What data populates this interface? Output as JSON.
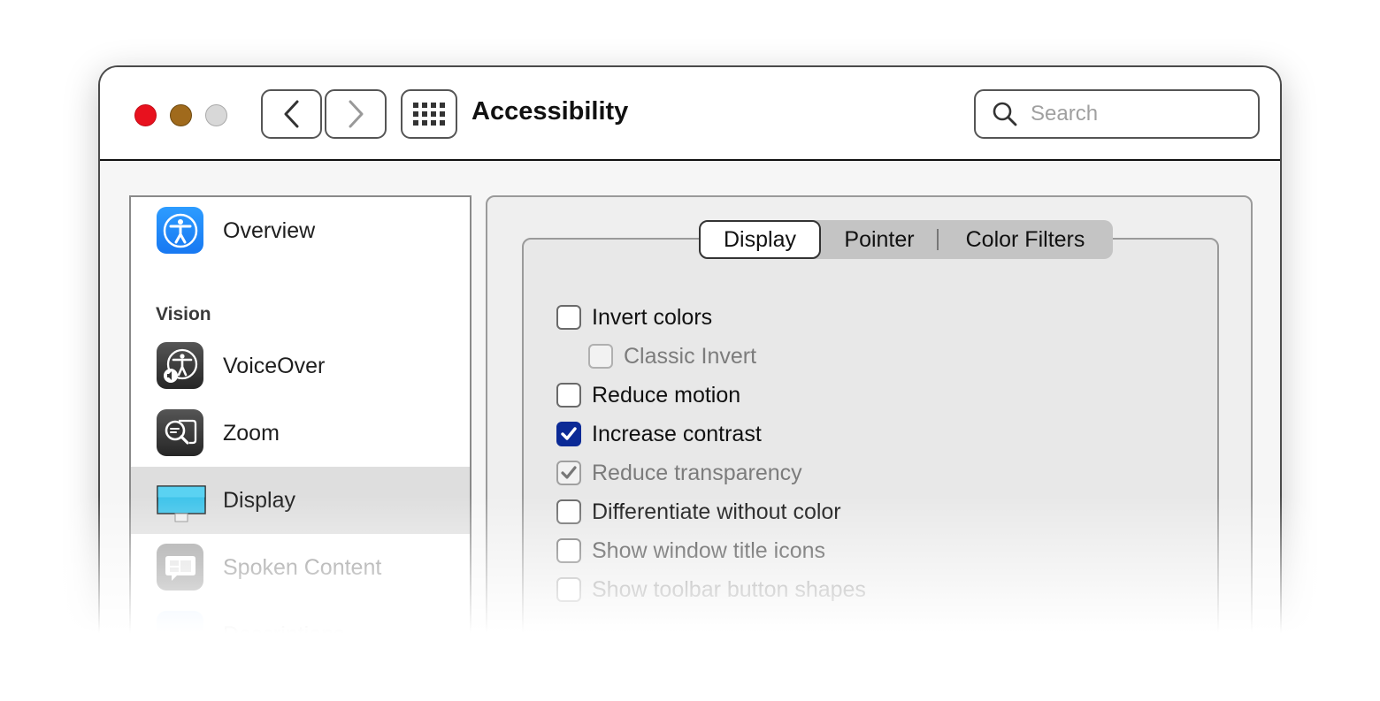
{
  "window": {
    "title": "Accessibility",
    "traffic_lights": [
      {
        "name": "close",
        "color": "#e8111e"
      },
      {
        "name": "minimize",
        "color": "#a06a1c"
      },
      {
        "name": "zoom",
        "color": "#d8d8d8"
      }
    ]
  },
  "toolbar": {
    "back_icon": "chevron-left",
    "forward_icon": "chevron-right",
    "show_all_icon": "grid-dots",
    "search": {
      "placeholder": "Search",
      "value": ""
    }
  },
  "sidebar": {
    "items": [
      {
        "label": "Overview",
        "icon": "accessibility-icon",
        "selected": false
      },
      {
        "label": "VoiceOver",
        "icon": "voiceover-icon",
        "selected": false
      },
      {
        "label": "Zoom",
        "icon": "zoom-icon",
        "selected": false
      },
      {
        "label": "Display",
        "icon": "display-icon",
        "selected": true
      },
      {
        "label": "Spoken Content",
        "icon": "spoken-content-icon",
        "selected": false
      },
      {
        "label": "Descriptions",
        "icon": "descriptions-icon",
        "selected": false
      }
    ],
    "section_vision": "Vision"
  },
  "content": {
    "tabs": [
      {
        "label": "Display",
        "active": true
      },
      {
        "label": "Pointer",
        "active": false
      },
      {
        "label": "Color Filters",
        "active": false
      }
    ],
    "options": [
      {
        "label": "Invert colors",
        "checked": false,
        "enabled": true,
        "indent": false
      },
      {
        "label": "Classic Invert",
        "checked": false,
        "enabled": false,
        "indent": true
      },
      {
        "label": "Reduce motion",
        "checked": false,
        "enabled": true,
        "indent": false
      },
      {
        "label": "Increase contrast",
        "checked": true,
        "enabled": true,
        "indent": false
      },
      {
        "label": "Reduce transparency",
        "checked": true,
        "enabled": false,
        "indent": false
      },
      {
        "label": "Differentiate without color",
        "checked": false,
        "enabled": true,
        "indent": false
      },
      {
        "label": "Show window title icons",
        "checked": false,
        "enabled": true,
        "indent": false
      },
      {
        "label": "Show toolbar button shapes",
        "checked": false,
        "enabled": false,
        "indent": false
      }
    ],
    "accent_color": "#0b2a96"
  }
}
